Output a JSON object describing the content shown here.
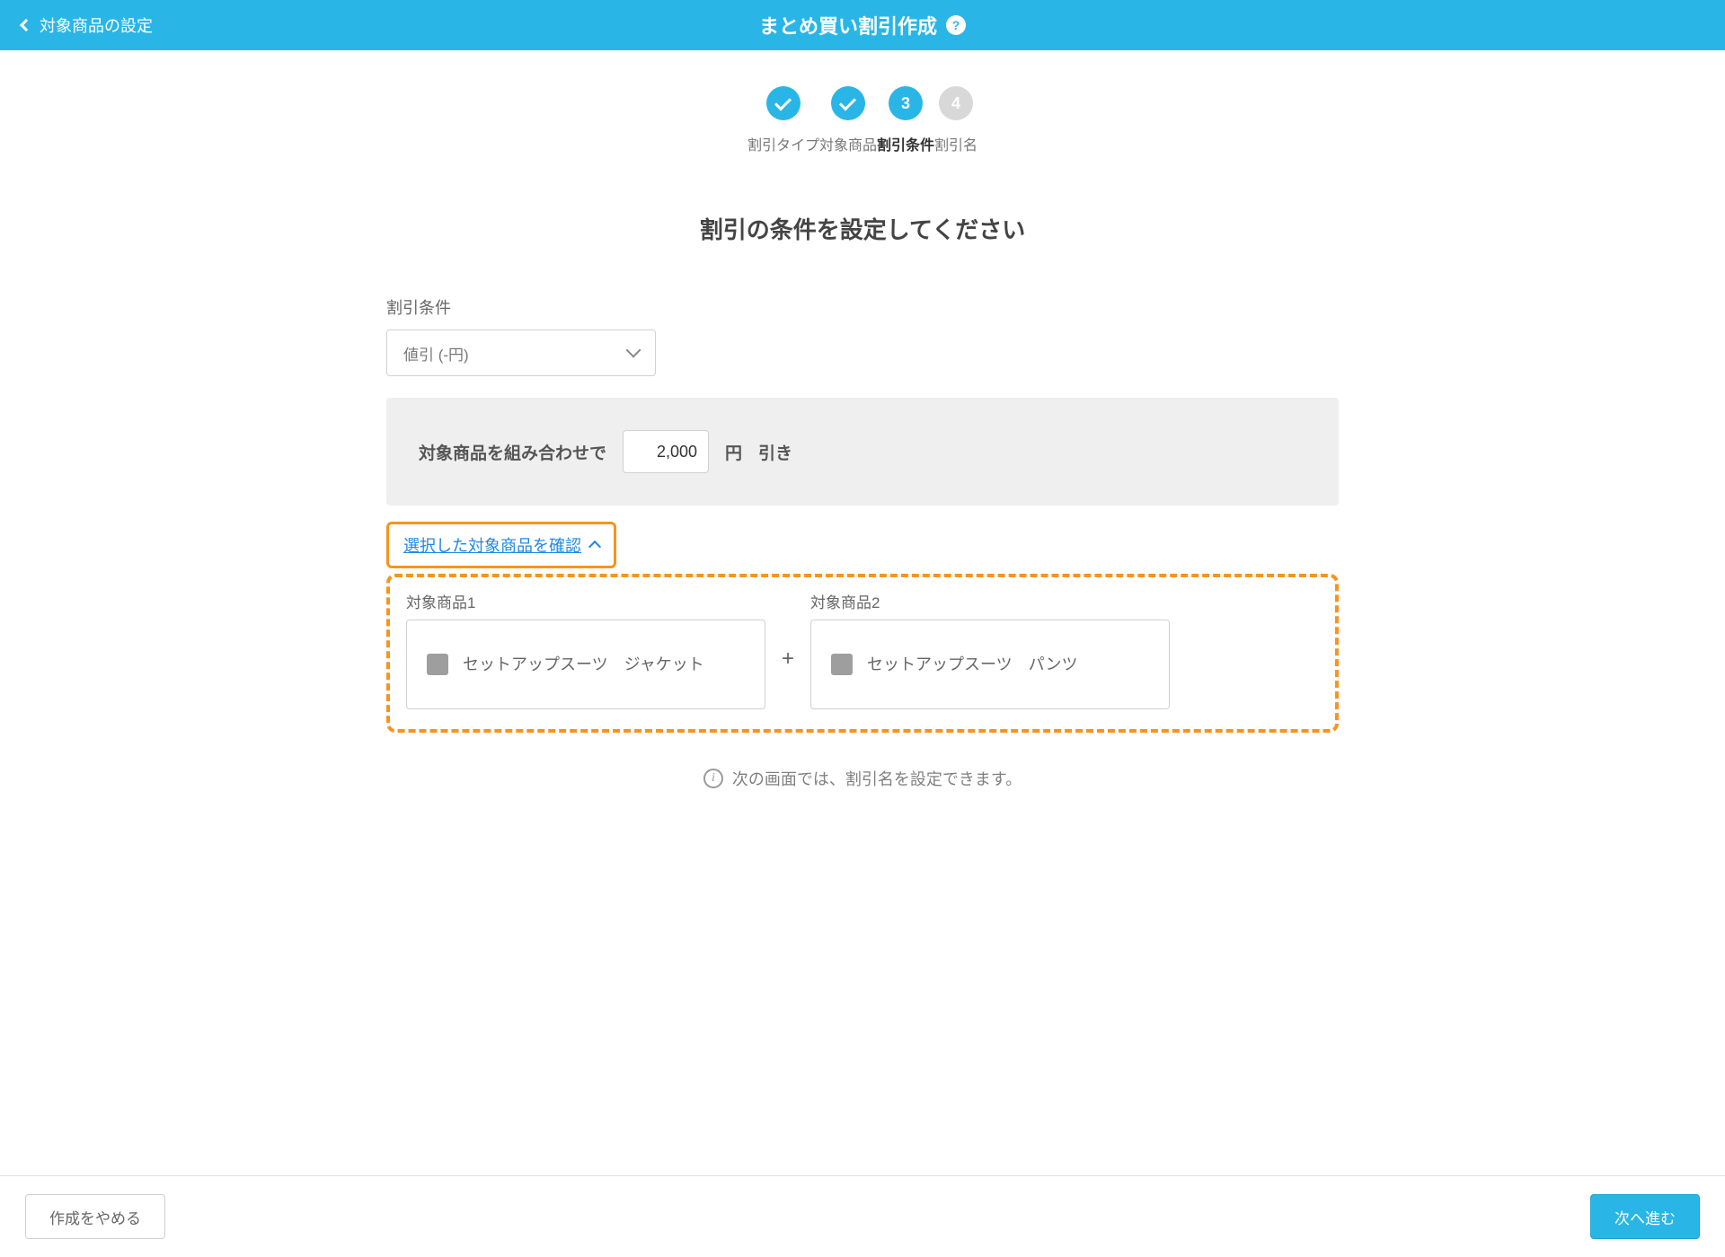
{
  "header": {
    "back_label": "対象商品の設定",
    "title": "まとめ買い割引作成",
    "help": "?"
  },
  "stepper": {
    "steps": [
      {
        "label": "割引タイプ",
        "state": "done"
      },
      {
        "label": "対象商品",
        "state": "done"
      },
      {
        "label": "割引条件",
        "state": "current",
        "number": "3"
      },
      {
        "label": "割引名",
        "state": "future",
        "number": "4"
      }
    ]
  },
  "page_heading": "割引の条件を設定してください",
  "condition": {
    "section_label": "割引条件",
    "select_value": "値引 (-円)",
    "panel_prefix": "対象商品を組み合わせで",
    "amount": "2,000",
    "unit": "円",
    "suffix": "引き"
  },
  "confirm_link": "選択した対象商品を確認",
  "products": {
    "items": [
      {
        "col_label": "対象商品1",
        "name": "セットアップスーツ　ジャケット"
      },
      {
        "col_label": "対象商品2",
        "name": "セットアップスーツ　パンツ"
      }
    ],
    "separator": "+"
  },
  "hint": "次の画面では、割引名を設定できます。",
  "footer": {
    "cancel": "作成をやめる",
    "next": "次へ進む"
  }
}
